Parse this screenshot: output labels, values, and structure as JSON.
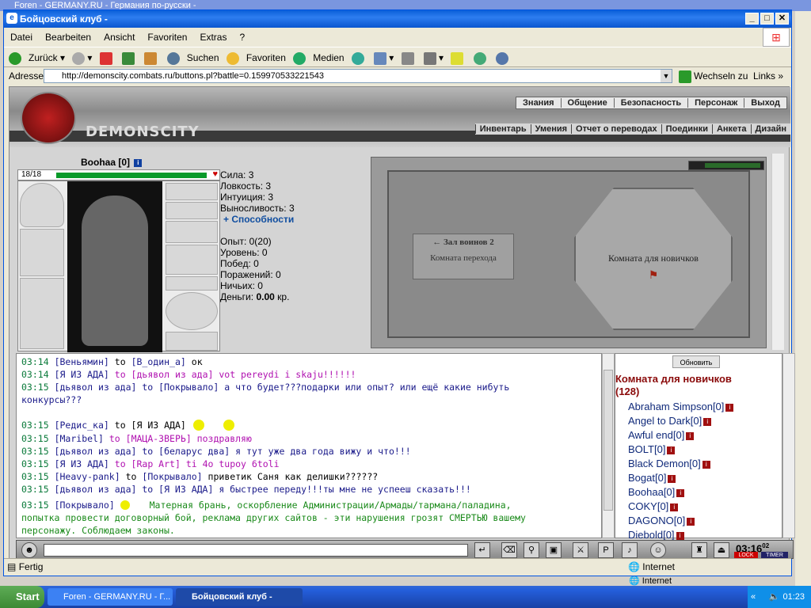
{
  "bg_window": {
    "title": "Foren - GERMANY.RU - Германия по-русски -",
    "status": "Internet"
  },
  "window": {
    "title": "Бойцовский клуб -"
  },
  "menu": [
    "Datei",
    "Bearbeiten",
    "Ansicht",
    "Favoriten",
    "Extras",
    "?"
  ],
  "toolbar": {
    "back": "Zurück",
    "search": "Suchen",
    "favorites": "Favoriten",
    "media": "Medien"
  },
  "address": {
    "label": "Adresse",
    "url": "http://demonscity.combats.ru/buttons.pl?battle=0.159970533221543",
    "go": "Wechseln zu",
    "links": "Links"
  },
  "site": {
    "logo_text": "DEMONSCITY",
    "nav1": [
      "Знания",
      "Общение",
      "Безопасность",
      "Персонаж",
      "Выход"
    ],
    "nav2": [
      "Инвентарь",
      "Умения",
      "Отчет о переводах",
      "Поединки",
      "Анкета",
      "Дизайн"
    ]
  },
  "character": {
    "name": "Boohaa [0]",
    "hp": "18/18",
    "stats": [
      "Сила: 3",
      "Ловкость: 3",
      "Интуиция: 3",
      "Выносливость: 3"
    ],
    "abilities": "+ Способности",
    "info": [
      "Опыт: 0(20)",
      "Уровень: 0",
      "Побед: 0",
      "Поражений: 0",
      "Ничьих: 0"
    ],
    "money_label": "Деньги:",
    "money_value": "0.00",
    "money_unit": "кр."
  },
  "map": {
    "room_left_sign": "← Зал воинов 2",
    "room_left": "Комната перехода",
    "room_right": "Комната для новичков"
  },
  "chat": [
    {
      "time": "03:14",
      "from": "Веньямин",
      "to": "В_один_а",
      "msg": "ок",
      "kind": "normal"
    },
    {
      "time": "03:14",
      "from": "Я ИЗ АДА",
      "to": "дьявол из ада",
      "msg": "vot pereydi i skaju!!!!!!",
      "kind": "private"
    },
    {
      "time": "03:15",
      "from": "дьявол из ада",
      "to": "Покрывало",
      "msg": "а что будет???подарки или опыт? или ещё какие нибуть",
      "kind": "normal"
    },
    {
      "time": "",
      "from": "",
      "to": "",
      "msg": "конкурсы???",
      "kind": "cont"
    },
    {
      "time": "03:15",
      "from": "Редис_ка",
      "to": "Я ИЗ АДА",
      "msg": "",
      "kind": "normal"
    },
    {
      "time": "03:15",
      "from": "Maribel",
      "to": "МАЦА-ЗВЕРЬ",
      "msg": "поздравляю",
      "kind": "private"
    },
    {
      "time": "03:15",
      "from": "дьявол из ада",
      "to": "беларус два",
      "msg": "я тут уже два года вижу и что!!!",
      "kind": "normal"
    },
    {
      "time": "03:15",
      "from": "Я ИЗ АДА",
      "to": "Rap Art",
      "msg": "ti 4o tupoy 6toli",
      "kind": "private"
    },
    {
      "time": "03:15",
      "from": "Heavy-pank",
      "to": "Покрывало",
      "msg": "приветик Саня как делишки??????",
      "kind": "normal"
    },
    {
      "time": "03:15",
      "from": "дьявол из ада",
      "to": "Я ИЗ АДА",
      "msg": "я быстрее переду!!!ты мне не успееш сказать!!!",
      "kind": "normal"
    }
  ],
  "sys_msg": {
    "time": "03:15",
    "from": "Покрывало",
    "line1": "Матерная брань, оскорбление Администрации/Армады/тармана/паладина,",
    "line2": "попытка провести договорный бой, реклама других сайтов - эти нарушения грозят СМЕРТЬЮ вашему",
    "line3": "персонажу. Соблюдаем законы."
  },
  "to_word": "to",
  "room_panel": {
    "refresh": "Обновить",
    "title": "Комната для новичков",
    "count": "(128)"
  },
  "users": [
    "Abraham Simpson[0]",
    "Angel to Dark[0]",
    "Awful end[0]",
    "BOLT[0]",
    "Black Demon[0]",
    "Bogat[0]",
    "Boohaa[0]",
    "COKY[0]",
    "DAGONO[0]",
    "Diebold[0]"
  ],
  "clock": {
    "time": "03:16",
    "sec": "02",
    "lock": "LOCK",
    "timer": "TIMER"
  },
  "status": {
    "left": "Fertig",
    "zone": "Internet"
  },
  "taskbar": {
    "start": "Start",
    "task1": "Foren - GERMANY.RU - Г...",
    "task2": "Бойцовский клуб -",
    "clock": "01:23"
  },
  "colors": {
    "hp": "#0a9a2a",
    "title_bar": "#0a5fd8",
    "taskbar": "#245edb"
  }
}
